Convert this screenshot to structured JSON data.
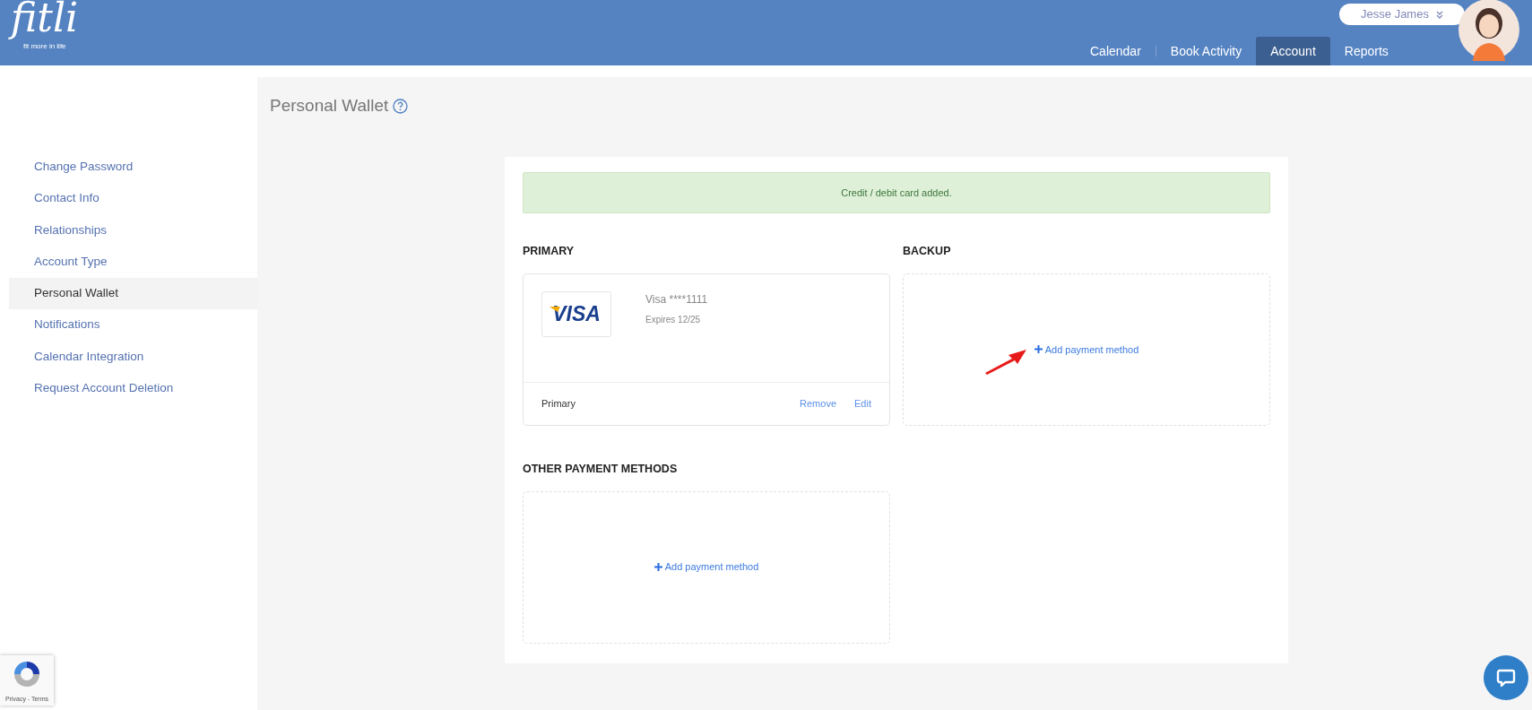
{
  "logo": {
    "name": "fitli",
    "tagline": "fit more in life"
  },
  "user_menu": {
    "name": "Jesse James"
  },
  "nav": [
    {
      "label": "Calendar",
      "selected": false
    },
    {
      "label": "Book Activity",
      "selected": false
    },
    {
      "label": "Account",
      "selected": true
    },
    {
      "label": "Reports",
      "selected": false
    }
  ],
  "sidebar": {
    "items": [
      {
        "label": "Change Password",
        "selected": false
      },
      {
        "label": "Contact Info",
        "selected": false
      },
      {
        "label": "Relationships",
        "selected": false
      },
      {
        "label": "Account Type",
        "selected": false
      },
      {
        "label": "Personal Wallet",
        "selected": true
      },
      {
        "label": "Notifications",
        "selected": false
      },
      {
        "label": "Calendar Integration",
        "selected": false
      },
      {
        "label": "Request Account Deletion",
        "selected": false
      }
    ]
  },
  "page_title": "Personal Wallet",
  "alert": "Credit / debit card added.",
  "sections": [
    {
      "title": "PRIMARY",
      "kind": "card",
      "card": {
        "logo_text": "VISA",
        "number": "Visa ****1111",
        "expires": "Expires 12/25",
        "footer_label": "Primary",
        "actions": [
          "Remove",
          "Edit"
        ]
      }
    },
    {
      "title": "BACKUP",
      "kind": "empty",
      "add_label": "Add payment method"
    },
    {
      "title": "OTHER PAYMENT METHODS",
      "kind": "empty",
      "add_label": "Add payment method"
    }
  ],
  "recaptcha": {
    "links": "Privacy - Terms"
  }
}
